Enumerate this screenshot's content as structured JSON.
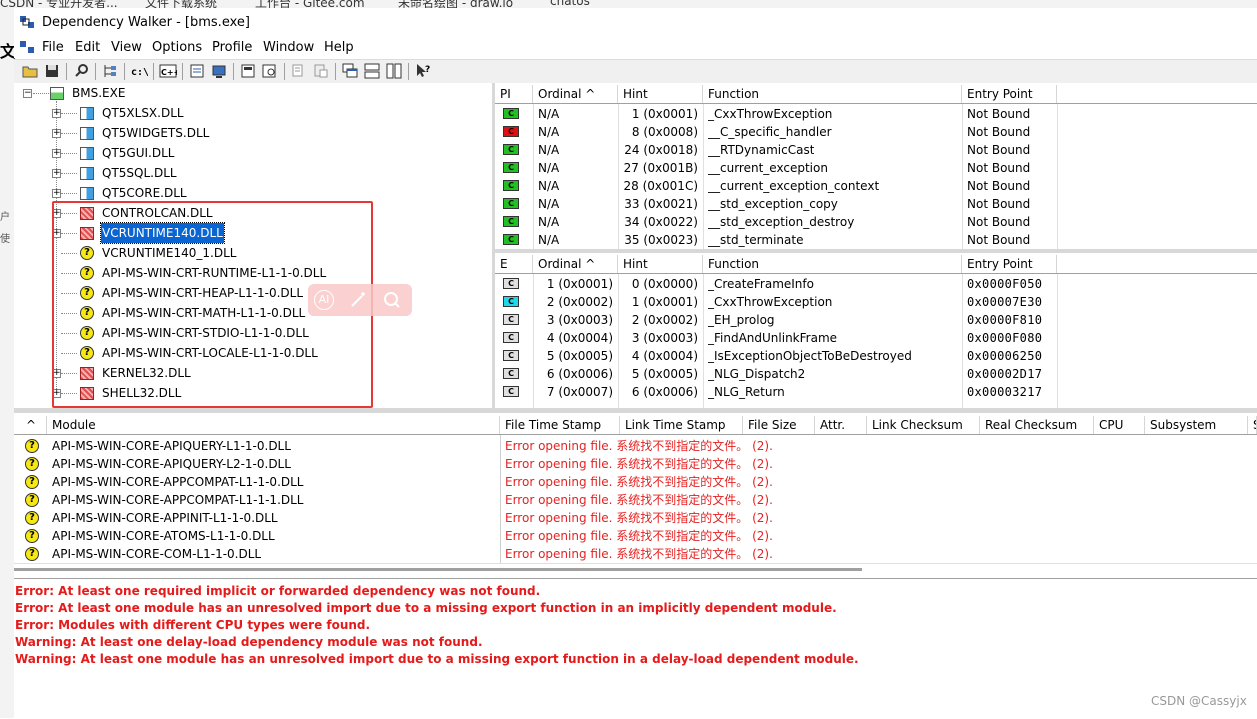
{
  "background_tabs": [
    "CSDN - 专业开发者...",
    "文件下载系统",
    "工作台 - Gitee.com",
    "未命名绘图 - draw.io",
    "chatos"
  ],
  "window": {
    "title": "Dependency Walker - [bms.exe]"
  },
  "menu": [
    "File",
    "Edit",
    "View",
    "Options",
    "Profile",
    "Window",
    "Help"
  ],
  "side_chars": [
    "文",
    "户",
    "使"
  ],
  "tree": {
    "root": "BMS.EXE",
    "items": [
      {
        "label": "QT5XLSX.DLL",
        "icon": "module-icon",
        "expandable": true
      },
      {
        "label": "QT5WIDGETS.DLL",
        "icon": "module-icon",
        "expandable": true
      },
      {
        "label": "QT5GUI.DLL",
        "icon": "module-icon",
        "expandable": true
      },
      {
        "label": "QT5SQL.DLL",
        "icon": "module-icon",
        "expandable": true
      },
      {
        "label": "QT5CORE.DLL",
        "icon": "module-icon",
        "expandable": true
      },
      {
        "label": "CONTROLCAN.DLL",
        "icon": "module-error-icon",
        "expandable": true
      },
      {
        "label": "VCRUNTIME140.DLL",
        "icon": "module-error-icon",
        "expandable": true,
        "selected": true
      },
      {
        "label": "VCRUNTIME140_1.DLL",
        "icon": "missing-module-icon",
        "expandable": false
      },
      {
        "label": "API-MS-WIN-CRT-RUNTIME-L1-1-0.DLL",
        "icon": "missing-module-icon",
        "expandable": false
      },
      {
        "label": "API-MS-WIN-CRT-HEAP-L1-1-0.DLL",
        "icon": "missing-module-icon",
        "expandable": false
      },
      {
        "label": "API-MS-WIN-CRT-MATH-L1-1-0.DLL",
        "icon": "missing-module-icon",
        "expandable": false
      },
      {
        "label": "API-MS-WIN-CRT-STDIO-L1-1-0.DLL",
        "icon": "missing-module-icon",
        "expandable": false
      },
      {
        "label": "API-MS-WIN-CRT-LOCALE-L1-1-0.DLL",
        "icon": "missing-module-icon",
        "expandable": false
      },
      {
        "label": "KERNEL32.DLL",
        "icon": "module-error-icon",
        "expandable": true
      },
      {
        "label": "SHELL32.DLL",
        "icon": "module-error-icon",
        "expandable": true
      }
    ]
  },
  "ai_toolbar": {
    "ai_label": "AI"
  },
  "imports": {
    "headers": [
      "PI",
      "Ordinal ^",
      "Hint",
      "Function",
      "Entry Point"
    ],
    "rows": [
      {
        "pi": "C",
        "pi_color": "#22c022",
        "ordinal": "N/A",
        "hint": "1 (0x0001)",
        "function": "_CxxThrowException",
        "entry": "Not Bound"
      },
      {
        "pi": "C",
        "pi_color": "#e01010",
        "ordinal": "N/A",
        "hint": "8 (0x0008)",
        "function": "__C_specific_handler",
        "entry": "Not Bound"
      },
      {
        "pi": "C",
        "pi_color": "#22c022",
        "ordinal": "N/A",
        "hint": "24 (0x0018)",
        "function": "__RTDynamicCast",
        "entry": "Not Bound"
      },
      {
        "pi": "C",
        "pi_color": "#22c022",
        "ordinal": "N/A",
        "hint": "27 (0x001B)",
        "function": "__current_exception",
        "entry": "Not Bound"
      },
      {
        "pi": "C",
        "pi_color": "#22c022",
        "ordinal": "N/A",
        "hint": "28 (0x001C)",
        "function": "__current_exception_context",
        "entry": "Not Bound"
      },
      {
        "pi": "C",
        "pi_color": "#22c022",
        "ordinal": "N/A",
        "hint": "33 (0x0021)",
        "function": "__std_exception_copy",
        "entry": "Not Bound"
      },
      {
        "pi": "C",
        "pi_color": "#22c022",
        "ordinal": "N/A",
        "hint": "34 (0x0022)",
        "function": "__std_exception_destroy",
        "entry": "Not Bound"
      },
      {
        "pi": "C",
        "pi_color": "#22c022",
        "ordinal": "N/A",
        "hint": "35 (0x0023)",
        "function": "__std_terminate",
        "entry": "Not Bound"
      }
    ]
  },
  "exports": {
    "headers": [
      "E",
      "Ordinal ^",
      "Hint",
      "Function",
      "Entry Point"
    ],
    "rows": [
      {
        "e": "C",
        "e_color": "#e0e0e0",
        "ordinal": "1 (0x0001)",
        "hint": "0 (0x0000)",
        "function": "_CreateFrameInfo",
        "entry": "0x0000F050"
      },
      {
        "e": "C",
        "e_color": "#22d8e8",
        "ordinal": "2 (0x0002)",
        "hint": "1 (0x0001)",
        "function": "_CxxThrowException",
        "entry": "0x00007E30"
      },
      {
        "e": "C",
        "e_color": "#e0e0e0",
        "ordinal": "3 (0x0003)",
        "hint": "2 (0x0002)",
        "function": "_EH_prolog",
        "entry": "0x0000F810"
      },
      {
        "e": "C",
        "e_color": "#e0e0e0",
        "ordinal": "4 (0x0004)",
        "hint": "3 (0x0003)",
        "function": "_FindAndUnlinkFrame",
        "entry": "0x0000F080"
      },
      {
        "e": "C",
        "e_color": "#e0e0e0",
        "ordinal": "5 (0x0005)",
        "hint": "4 (0x0004)",
        "function": "_IsExceptionObjectToBeDestroyed",
        "entry": "0x00006250"
      },
      {
        "e": "C",
        "e_color": "#e0e0e0",
        "ordinal": "6 (0x0006)",
        "hint": "5 (0x0005)",
        "function": "_NLG_Dispatch2",
        "entry": "0x00002D17"
      },
      {
        "e": "C",
        "e_color": "#e0e0e0",
        "ordinal": "7 (0x0007)",
        "hint": "6 (0x0006)",
        "function": "_NLG_Return",
        "entry": "0x00003217"
      }
    ]
  },
  "modules": {
    "headers": [
      "^",
      "Module",
      "File Time Stamp",
      "Link Time Stamp",
      "File Size",
      "Attr.",
      "Link Checksum",
      "Real Checksum",
      "CPU",
      "Subsystem",
      "Sym"
    ],
    "error_text": "Error opening file. 系统找不到指定的文件。 (2).",
    "rows": [
      "API-MS-WIN-CORE-APIQUERY-L1-1-0.DLL",
      "API-MS-WIN-CORE-APIQUERY-L2-1-0.DLL",
      "API-MS-WIN-CORE-APPCOMPAT-L1-1-0.DLL",
      "API-MS-WIN-CORE-APPCOMPAT-L1-1-1.DLL",
      "API-MS-WIN-CORE-APPINIT-L1-1-0.DLL",
      "API-MS-WIN-CORE-ATOMS-L1-1-0.DLL",
      "API-MS-WIN-CORE-COM-L1-1-0.DLL"
    ]
  },
  "log": [
    "Error: At least one required implicit or forwarded dependency was not found.",
    "Error: At least one module has an unresolved import due to a missing export function in an implicitly dependent module.",
    "Error: Modules with different CPU types were found.",
    "Warning: At least one delay-load dependency module was not found.",
    "Warning: At least one module has an unresolved import due to a missing export function in a delay-load dependent module."
  ],
  "watermark": "CSDN @Cassyjx",
  "colors": {
    "error_red": "#e51a1a",
    "annotation_red": "#e53935",
    "selection_blue": "#0a64d2"
  }
}
